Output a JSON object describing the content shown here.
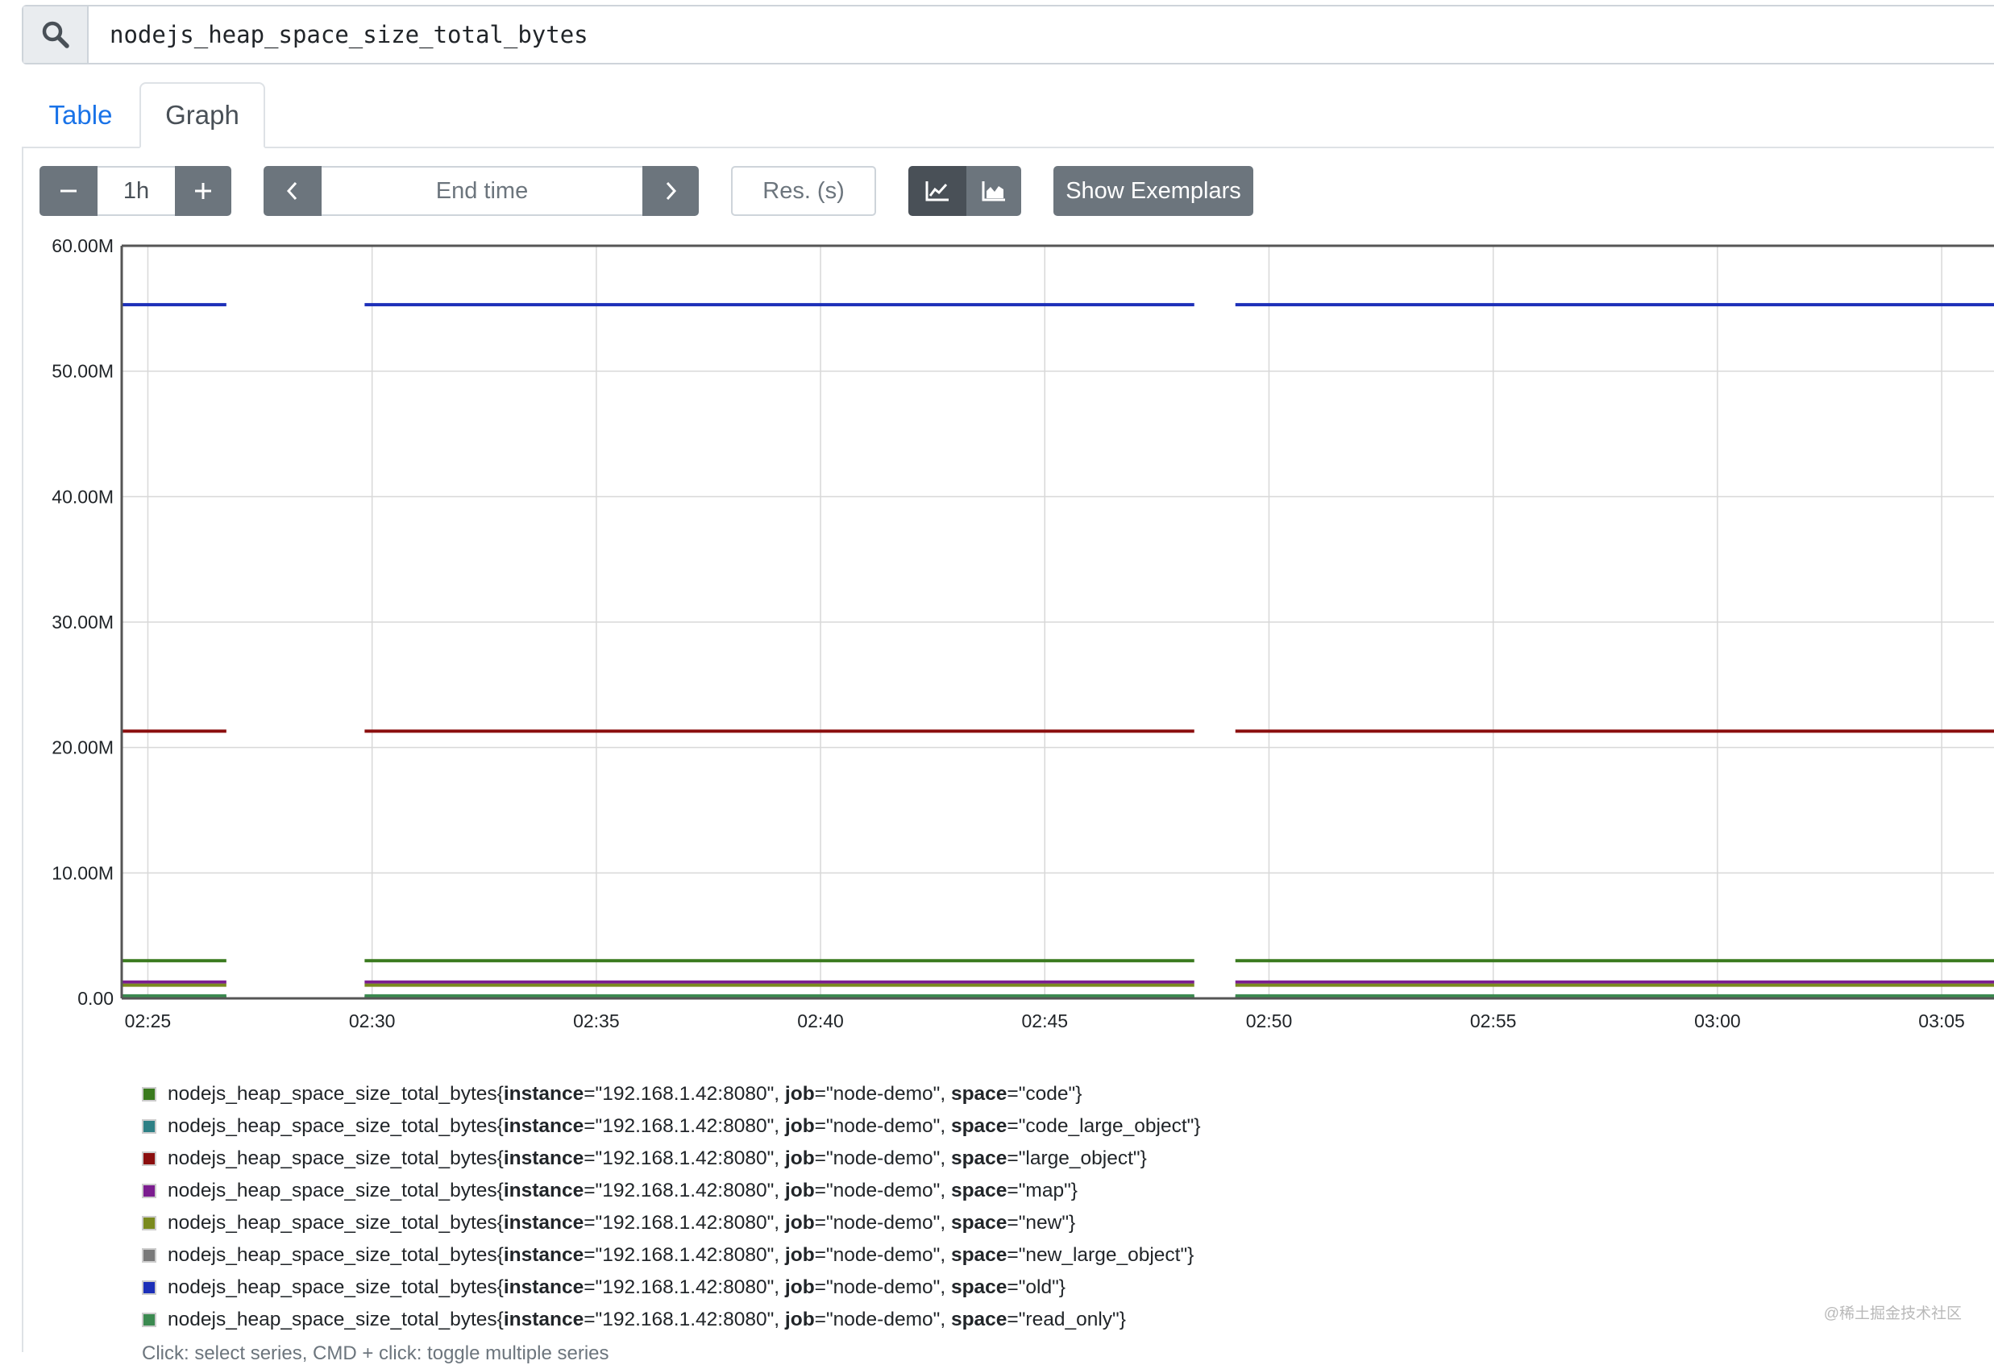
{
  "expression": {
    "value": "nodejs_heap_space_size_total_bytes",
    "icon": "search-icon"
  },
  "tabs": [
    {
      "label": "Table",
      "active": false
    },
    {
      "label": "Graph",
      "active": true
    }
  ],
  "controls": {
    "range_decrease_icon": "minus-icon",
    "range_value": "1h",
    "range_increase_icon": "plus-icon",
    "end_time_prev_icon": "chevron-left-icon",
    "end_time_placeholder": "End time",
    "end_time_next_icon": "chevron-right-icon",
    "resolution_placeholder": "Res. (s)",
    "line_chart_icon": "line-chart-icon",
    "stacked_chart_icon": "area-chart-icon",
    "exemplars_label": "Show Exemplars"
  },
  "colors": {
    "accent_blue": "#1a73e8",
    "button_gray": "#6c757d",
    "button_dark": "#495057"
  },
  "chart_data": {
    "type": "line",
    "xlabel": "",
    "ylabel": "",
    "y_ticks": [
      "0.00",
      "10.00M",
      "20.00M",
      "30.00M",
      "40.00M",
      "50.00M",
      "60.00M"
    ],
    "ylim": [
      0,
      60000000
    ],
    "x_ticks": [
      "02:25",
      "02:30",
      "02:35",
      "02:40",
      "02:45",
      "02:50",
      "02:55",
      "03:00",
      "03:05"
    ],
    "x_range": [
      "02:24:25",
      "03:06:10"
    ],
    "grid": true,
    "segments": [
      [
        "02:24:25",
        "02:26:45"
      ],
      [
        "02:29:50",
        "02:48:20"
      ],
      [
        "02:49:15",
        "03:06:10"
      ]
    ],
    "series": [
      {
        "space": "code",
        "color": "#3a7a1e",
        "value": 3000000
      },
      {
        "space": "code_large_object",
        "color": "#2e8085",
        "value": 100000
      },
      {
        "space": "large_object",
        "color": "#8b0e0e",
        "value": 21300000
      },
      {
        "space": "map",
        "color": "#7b1d8f",
        "value": 1300000
      },
      {
        "space": "new",
        "color": "#7a8a1e",
        "value": 1050000
      },
      {
        "space": "new_large_object",
        "color": "#7a7a7a",
        "value": 60000
      },
      {
        "space": "old",
        "color": "#1c2fb8",
        "value": 55300000
      },
      {
        "space": "read_only",
        "color": "#3b8a50",
        "value": 200000
      }
    ]
  },
  "legend": {
    "metric": "nodejs_heap_space_size_total_bytes",
    "instance": "192.168.1.42:8080",
    "job": "node-demo",
    "items": [
      {
        "space": "code",
        "color": "#3a7a1e"
      },
      {
        "space": "code_large_object",
        "color": "#2e8085"
      },
      {
        "space": "large_object",
        "color": "#8b0e0e"
      },
      {
        "space": "map",
        "color": "#7b1d8f"
      },
      {
        "space": "new",
        "color": "#7a8a1e"
      },
      {
        "space": "new_large_object",
        "color": "#7a7a7a"
      },
      {
        "space": "old",
        "color": "#1c2fb8"
      },
      {
        "space": "read_only",
        "color": "#3b8a50"
      }
    ],
    "hint": "Click: select series, CMD + click: toggle multiple series"
  },
  "watermark": "@稀土掘金技术社区"
}
